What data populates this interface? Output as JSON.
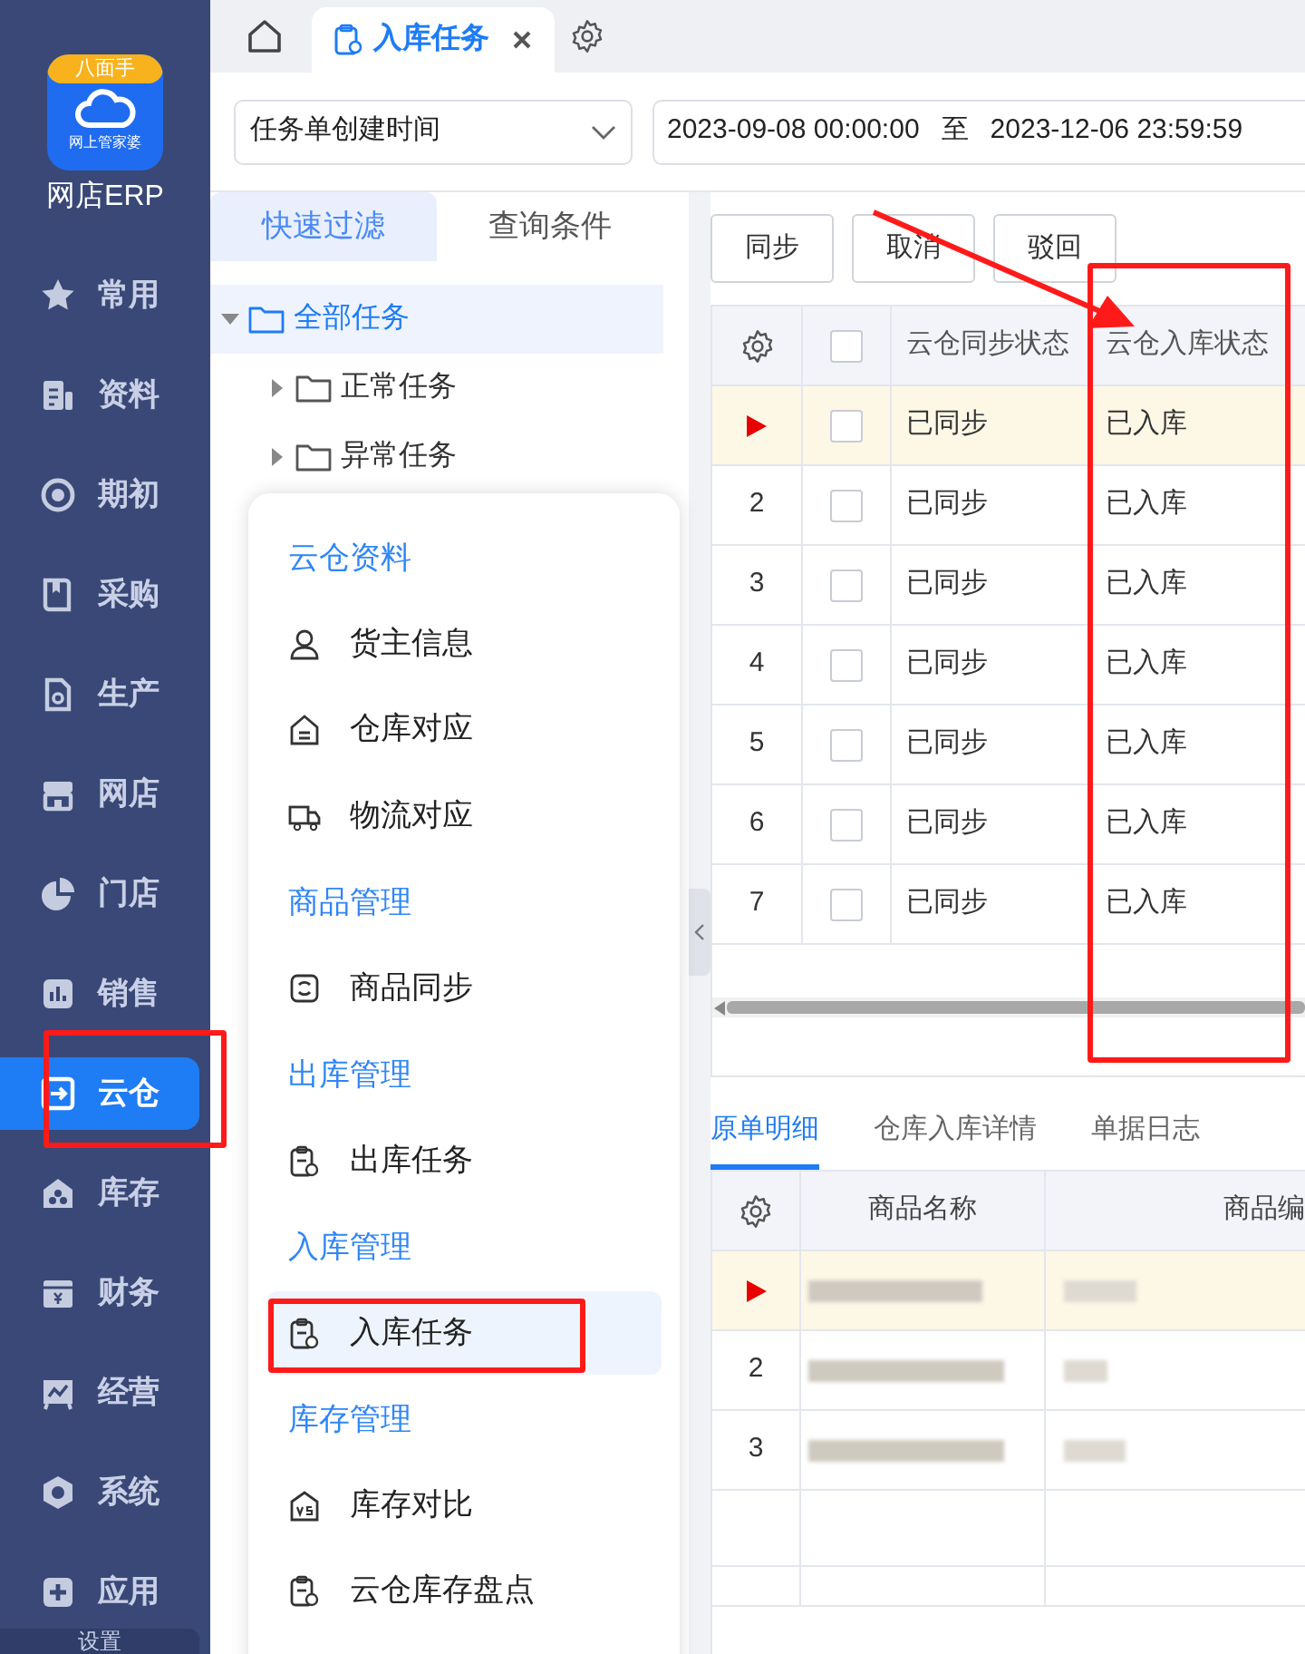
{
  "sidebar": {
    "logo": {
      "badge": "八面手",
      "caption": "网上管家婆"
    },
    "app_name": "网店ERP",
    "items": [
      {
        "label": "常用",
        "selected": false
      },
      {
        "label": "资料",
        "selected": false
      },
      {
        "label": "期初",
        "selected": false
      },
      {
        "label": "采购",
        "selected": false
      },
      {
        "label": "生产",
        "selected": false
      },
      {
        "label": "网店",
        "selected": false
      },
      {
        "label": "门店",
        "selected": false
      },
      {
        "label": "销售",
        "selected": false
      },
      {
        "label": "云仓",
        "selected": true
      },
      {
        "label": "库存",
        "selected": false
      },
      {
        "label": "财务",
        "selected": false
      },
      {
        "label": "经营",
        "selected": false
      },
      {
        "label": "系统",
        "selected": false
      },
      {
        "label": "应用",
        "selected": false
      }
    ],
    "footer": "设置"
  },
  "tab_bar": {
    "tabs": [
      {
        "label": "入库任务",
        "selected": true
      }
    ]
  },
  "filter": {
    "date_field": "任务单创建时间",
    "start": "2023-09-08 00:00:00",
    "separator": "至",
    "end": "2023-12-06 23:59:59"
  },
  "filter_panel": {
    "tabs": [
      {
        "label": "快速过滤",
        "selected": true
      },
      {
        "label": "查询条件",
        "selected": false
      }
    ],
    "tree": [
      {
        "label": "全部任务",
        "expanded": true,
        "selected": true,
        "children": [
          {
            "label": "正常任务",
            "expanded": false,
            "selected": false
          },
          {
            "label": "异常任务",
            "expanded": false,
            "selected": false
          }
        ]
      }
    ]
  },
  "popup_menu": {
    "items": [
      {
        "kind": "heading",
        "label": "云仓资料"
      },
      {
        "kind": "item",
        "label": "货主信息",
        "selected": false
      },
      {
        "kind": "item",
        "label": "仓库对应",
        "selected": false
      },
      {
        "kind": "item",
        "label": "物流对应",
        "selected": false
      },
      {
        "kind": "heading",
        "label": "商品管理"
      },
      {
        "kind": "item",
        "label": "商品同步",
        "selected": false
      },
      {
        "kind": "heading",
        "label": "出库管理"
      },
      {
        "kind": "item",
        "label": "出库任务",
        "selected": false
      },
      {
        "kind": "heading",
        "label": "入库管理"
      },
      {
        "kind": "item",
        "label": "入库任务",
        "selected": true
      },
      {
        "kind": "heading",
        "label": "库存管理"
      },
      {
        "kind": "item",
        "label": "库存对比",
        "selected": false
      },
      {
        "kind": "item",
        "label": "云仓库存盘点",
        "selected": false
      }
    ]
  },
  "toolbar": [
    "同步",
    "取消",
    "驳回"
  ],
  "task_table": {
    "select_all_checked": false,
    "columns": [
      "云仓同步状态",
      "云仓入库状态"
    ],
    "rows": [
      {
        "selected": true,
        "checked": false,
        "cells": [
          "已同步",
          "已入库"
        ]
      },
      {
        "number": "2",
        "selected": false,
        "checked": false,
        "cells": [
          "已同步",
          "已入库"
        ]
      },
      {
        "number": "3",
        "selected": false,
        "checked": false,
        "cells": [
          "已同步",
          "已入库"
        ]
      },
      {
        "number": "4",
        "selected": false,
        "checked": false,
        "cells": [
          "已同步",
          "已入库"
        ]
      },
      {
        "number": "5",
        "selected": false,
        "checked": false,
        "cells": [
          "已同步",
          "已入库"
        ]
      },
      {
        "number": "6",
        "selected": false,
        "checked": false,
        "cells": [
          "已同步",
          "已入库"
        ]
      },
      {
        "number": "7",
        "selected": false,
        "checked": false,
        "cells": [
          "已同步",
          "已入库"
        ]
      }
    ]
  },
  "detail_tabs": [
    {
      "label": "原单明细",
      "selected": true
    },
    {
      "label": "仓库入库详情",
      "selected": false
    },
    {
      "label": "单据日志",
      "selected": false
    }
  ],
  "detail_table": {
    "columns": [
      "商品名称",
      "商品编"
    ],
    "rows": [
      {
        "selected": true
      },
      {
        "number": "2",
        "selected": false
      },
      {
        "number": "3",
        "selected": false
      }
    ]
  }
}
